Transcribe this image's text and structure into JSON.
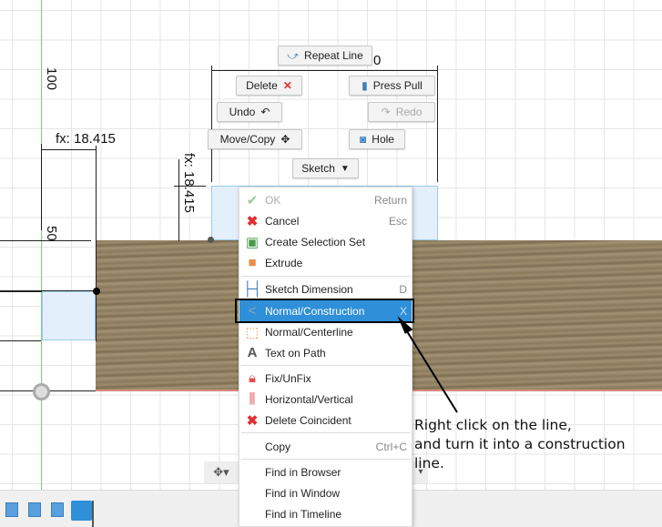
{
  "sketch": {
    "dim_top_partial": "0",
    "dim_left": "fx: 18.415",
    "dim_vertical": "fx: 18.415",
    "axis_label_100": "100",
    "axis_label_50": "50"
  },
  "marking_menu": {
    "repeat_line": "Repeat Line",
    "delete": "Delete",
    "press_pull": "Press Pull",
    "undo": "Undo",
    "redo": "Redo",
    "move_copy": "Move/Copy",
    "hole": "Hole",
    "sketch": "Sketch"
  },
  "context_menu": {
    "items": [
      {
        "label": "OK",
        "shortcut": "Return",
        "icon": "check-icon",
        "disabled": true
      },
      {
        "label": "Cancel",
        "shortcut": "Esc",
        "icon": "x-icon"
      },
      {
        "label": "Create Selection Set",
        "shortcut": "",
        "icon": "selection-set-icon"
      },
      {
        "label": "Extrude",
        "shortcut": "",
        "icon": "extrude-icon"
      },
      {
        "label": "Sketch Dimension",
        "shortcut": "D",
        "icon": "dimension-icon"
      },
      {
        "label": "Normal/Construction",
        "shortcut": "X",
        "icon": "construction-icon",
        "highlighted": true
      },
      {
        "label": "Normal/Centerline",
        "shortcut": "",
        "icon": "centerline-icon"
      },
      {
        "label": "Text on Path",
        "shortcut": "",
        "icon": "text-icon"
      },
      {
        "label": "Fix/UnFix",
        "shortcut": "",
        "icon": "lock-icon"
      },
      {
        "label": "Horizontal/Vertical",
        "shortcut": "",
        "icon": "horizontal-vertical-icon"
      },
      {
        "label": "Delete Coincident",
        "shortcut": "",
        "icon": "delete-coincident-icon"
      },
      {
        "label": "Copy",
        "shortcut": "Ctrl+C",
        "icon": ""
      },
      {
        "label": "Find in Browser",
        "shortcut": "",
        "icon": ""
      },
      {
        "label": "Find in Window",
        "shortcut": "",
        "icon": ""
      },
      {
        "label": "Find in Timeline",
        "shortcut": "",
        "icon": ""
      }
    ]
  },
  "annotation": "Right click on the line,\nand turn it into a construction\nline.",
  "colors": {
    "highlight": "#2f8fd8",
    "axis_green": "#7fd07f",
    "accent_red": "#e03030"
  }
}
